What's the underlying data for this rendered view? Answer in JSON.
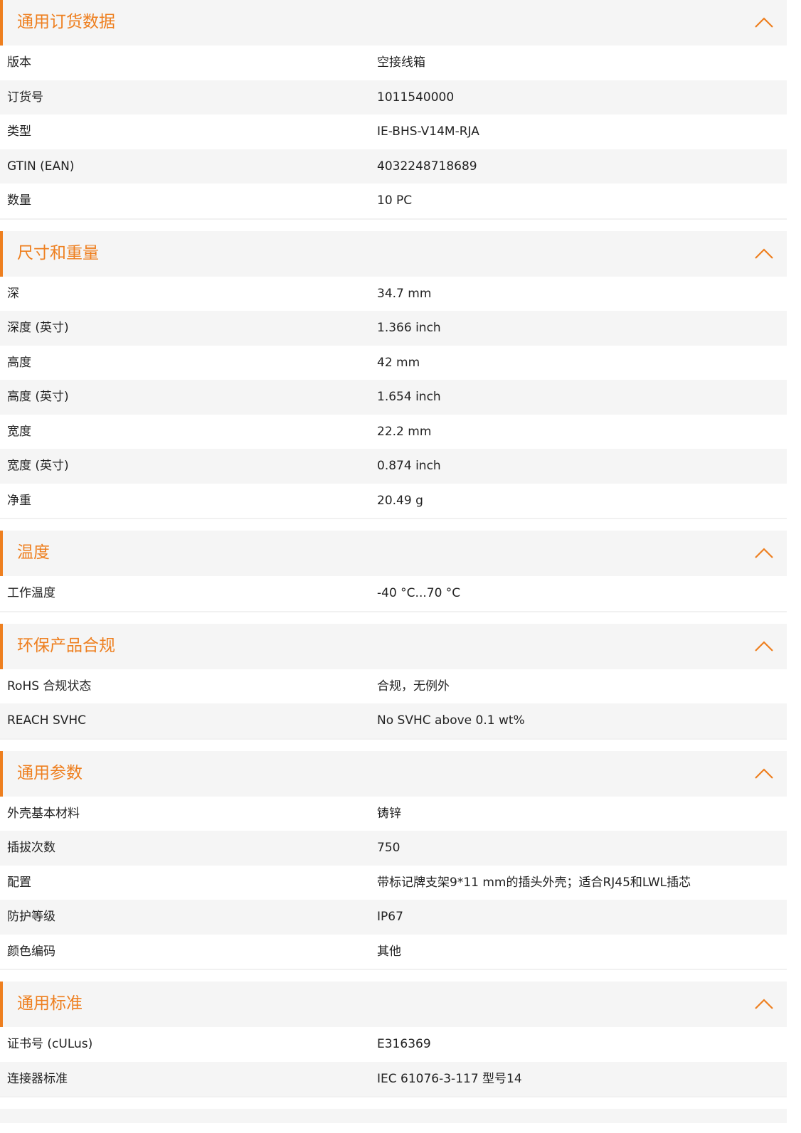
{
  "accent_color": "#ee7f1f",
  "sections": [
    {
      "title": "通用订货数据",
      "toggle_icon": "chevron-up-icon",
      "rows": [
        {
          "label": "版本",
          "value": "空接线箱"
        },
        {
          "label": "订货号",
          "value": "1011540000"
        },
        {
          "label": "类型",
          "value": "IE-BHS-V14M-RJA"
        },
        {
          "label": "GTIN (EAN)",
          "value": "4032248718689"
        },
        {
          "label": "数量",
          "value": "10  PC"
        }
      ]
    },
    {
      "title": "尺寸和重量",
      "toggle_icon": "chevron-up-icon",
      "rows": [
        {
          "label": "深",
          "value": "34.7  mm"
        },
        {
          "label": "深度 (英寸)",
          "value": "1.366  inch"
        },
        {
          "label": "高度",
          "value": "42  mm"
        },
        {
          "label": "高度 (英寸)",
          "value": "1.654  inch"
        },
        {
          "label": "宽度",
          "value": "22.2  mm"
        },
        {
          "label": "宽度 (英寸)",
          "value": "0.874  inch"
        },
        {
          "label": "净重",
          "value": "20.49  g"
        }
      ]
    },
    {
      "title": "温度",
      "toggle_icon": "chevron-up-icon",
      "rows": [
        {
          "label": "工作温度",
          "value": "-40 °C...70 °C"
        }
      ]
    },
    {
      "title": "环保产品合规",
      "toggle_icon": "chevron-up-icon",
      "rows": [
        {
          "label": "RoHS 合规状态",
          "value": "合规，无例外"
        },
        {
          "label": "REACH SVHC",
          "value": "No SVHC above 0.1 wt%"
        }
      ]
    },
    {
      "title": "通用参数",
      "toggle_icon": "chevron-up-icon",
      "rows": [
        {
          "label": "外壳基本材料",
          "value": "铸锌"
        },
        {
          "label": "插拔次数",
          "value": "750"
        },
        {
          "label": "配置",
          "value": "带标记牌支架9*11 mm的插头外壳；适合RJ45和LWL插芯"
        },
        {
          "label": "防护等级",
          "value": "IP67"
        },
        {
          "label": "颜色编码",
          "value": "其他"
        }
      ]
    },
    {
      "title": "通用标准",
      "toggle_icon": "chevron-up-icon",
      "rows": [
        {
          "label": "证书号 (cULus)",
          "value": "E316369"
        },
        {
          "label": "连接器标准",
          "value": "IEC 61076-3-117 型号14"
        }
      ]
    }
  ]
}
